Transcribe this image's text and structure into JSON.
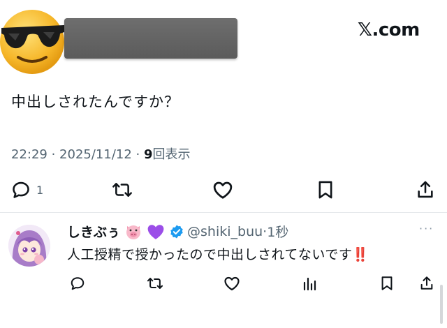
{
  "header": {
    "brand": "𝕏.com"
  },
  "tweet": {
    "text": "中出しされたんですか？",
    "time": "22:29",
    "sep1": " · ",
    "date": "2025/11/12",
    "sep2": " · ",
    "views": "9",
    "views_label": "回表示",
    "reply_count": "1"
  },
  "reply": {
    "name": "しきぶぅ",
    "handle": "@shiki_buu",
    "dot": "·",
    "time": "1秒",
    "text": "人工授精で授かったので中出しされてないです",
    "emphasis": "‼️",
    "more": "···"
  },
  "colors": {
    "verified": "#1d9bf0",
    "muted": "#536471",
    "emphasis": "#dd2233"
  }
}
